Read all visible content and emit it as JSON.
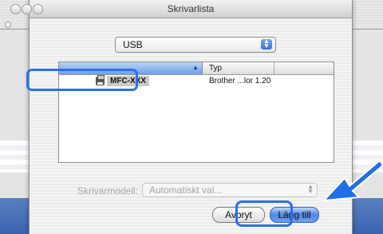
{
  "window": {
    "title": "Skrivarlista"
  },
  "connection_popup": {
    "selected": "USB"
  },
  "printer_list": {
    "columns": [
      "",
      "Typ"
    ],
    "rows": [
      {
        "name": "MFC-XXX",
        "type": "Brother ...lor 1.20"
      }
    ]
  },
  "printer_model": {
    "label": "Skrivarmodell:",
    "selected": "Automatiskt val..."
  },
  "buttons": {
    "cancel": "Avbryt",
    "add": "Lägg till"
  },
  "colors": {
    "highlight": "#2d6fe8",
    "pointer_arrow": "#1f6fe6"
  },
  "icons": {
    "sort": "sort-ascending-icon",
    "printer": "printer-icon",
    "pointer": "pointer-arrow-icon"
  }
}
